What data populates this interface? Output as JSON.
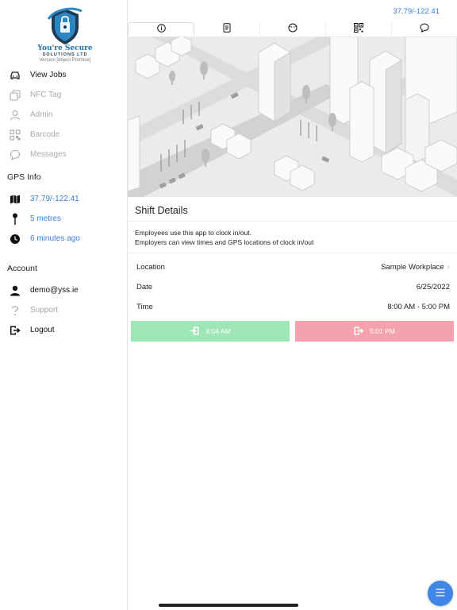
{
  "app": {
    "logo": {
      "name": "You're Secure",
      "sub": "SOLUTIONS LTD",
      "version": "Version [object Promise]"
    }
  },
  "sidebar": {
    "nav": [
      {
        "label": "View Jobs",
        "icon": "car-icon",
        "enabled": true
      },
      {
        "label": "NFC Tag",
        "icon": "nfc-copy-icon",
        "enabled": false
      },
      {
        "label": "Admin",
        "icon": "person-outline-icon",
        "enabled": false
      },
      {
        "label": "Barcode",
        "icon": "qr-code-icon",
        "enabled": false
      },
      {
        "label": "Messages",
        "icon": "chat-bubble-icon",
        "enabled": false
      }
    ],
    "gps_title": "GPS Info",
    "gps": [
      {
        "label": "37.79/-122.41",
        "icon": "map-icon"
      },
      {
        "label": "5 metres",
        "icon": "pin-icon"
      },
      {
        "label": "6 minutes ago",
        "icon": "clock-icon"
      }
    ],
    "account_title": "Account",
    "account": [
      {
        "label": "demo@yss.ie",
        "icon": "person-icon",
        "enabled": true
      },
      {
        "label": "Support",
        "icon": "question-icon",
        "enabled": false
      },
      {
        "label": "Logout",
        "icon": "logout-icon",
        "enabled": true
      }
    ]
  },
  "header": {
    "coords": "37.79/-122.41"
  },
  "tabs": [
    {
      "icon": "info-icon",
      "active": true
    },
    {
      "icon": "document-icon",
      "active": false
    },
    {
      "icon": "face-icon",
      "active": false
    },
    {
      "icon": "qr-code-icon",
      "active": false
    },
    {
      "icon": "chat-icon",
      "active": false
    }
  ],
  "shift": {
    "title": "Shift Details",
    "desc1": "Employees use this app to clock in/out.",
    "desc2": "Employers can view times and GPS locations of clock in/out",
    "rows": [
      {
        "key": "Location",
        "value": "Sample Workplace"
      },
      {
        "key": "Date",
        "value": "6/25/2022"
      },
      {
        "key": "Time",
        "value": "8:00 AM - 5:00 PM"
      }
    ],
    "clock_in": "8:04 AM",
    "clock_out": "5:01 PM"
  },
  "colors": {
    "accent": "#3f7dd6",
    "clock_in": "#9fe6b6",
    "clock_out": "#f4a2ad",
    "fab": "#3f86e6"
  }
}
